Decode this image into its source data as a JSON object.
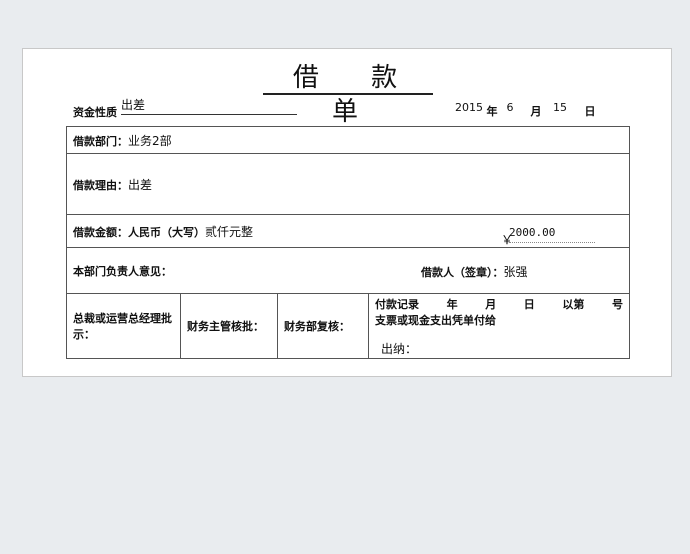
{
  "title": "借  款  单",
  "nature": {
    "label": "资金性质",
    "value": "出差"
  },
  "date": {
    "year": "2015",
    "year_label": "年",
    "month": "6",
    "month_label": "月",
    "day": "15",
    "day_label": "日"
  },
  "dept": {
    "label": "借款部门：",
    "value": "业务2部"
  },
  "reason": {
    "label": "借款理由：",
    "value": "出差"
  },
  "amount": {
    "label": "借款金额：",
    "rmb_label": "人民币（大写）",
    "words": "贰仟元整",
    "currency_symbol": "￥",
    "number": "2000.00"
  },
  "dept_head": {
    "label": "本部门负责人意见："
  },
  "borrower": {
    "label": "借款人（签章）：",
    "value": "张强"
  },
  "approvals": {
    "ceo": "总裁或运营总经理批示：",
    "finance_head": "财务主管核批：",
    "finance_review": "财务部复核："
  },
  "payment": {
    "record": "付款记录",
    "year": "年",
    "month": "月",
    "day": "日",
    "serial_prefix": "以第",
    "serial_suffix": "号",
    "line2": "支票或现金支出凭单付给",
    "cashier": "出纳："
  }
}
